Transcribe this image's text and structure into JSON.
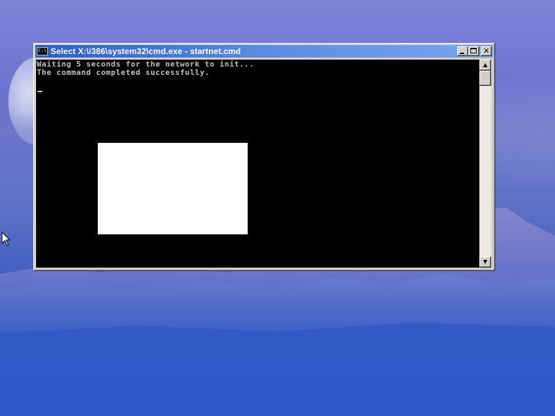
{
  "window": {
    "title": "Select X:\\i386\\system32\\cmd.exe - startnet.cmd",
    "icon_label": "C:\\",
    "buttons": {
      "minimize_icon": "minimize-icon",
      "maximize_icon": "maximize-icon",
      "close_label": "✕"
    }
  },
  "console": {
    "lines": [
      "Waiting 5 seconds for the network to init...",
      "The command completed successfully."
    ],
    "text_color": "#c0c0c0",
    "background": "#000000"
  },
  "scrollbar": {
    "up_arrow": "▲",
    "down_arrow": "▼"
  },
  "colors": {
    "titlebar_start": "#2a5cc8",
    "titlebar_end": "#7aa6ee",
    "window_frame": "#d4d0c8"
  }
}
